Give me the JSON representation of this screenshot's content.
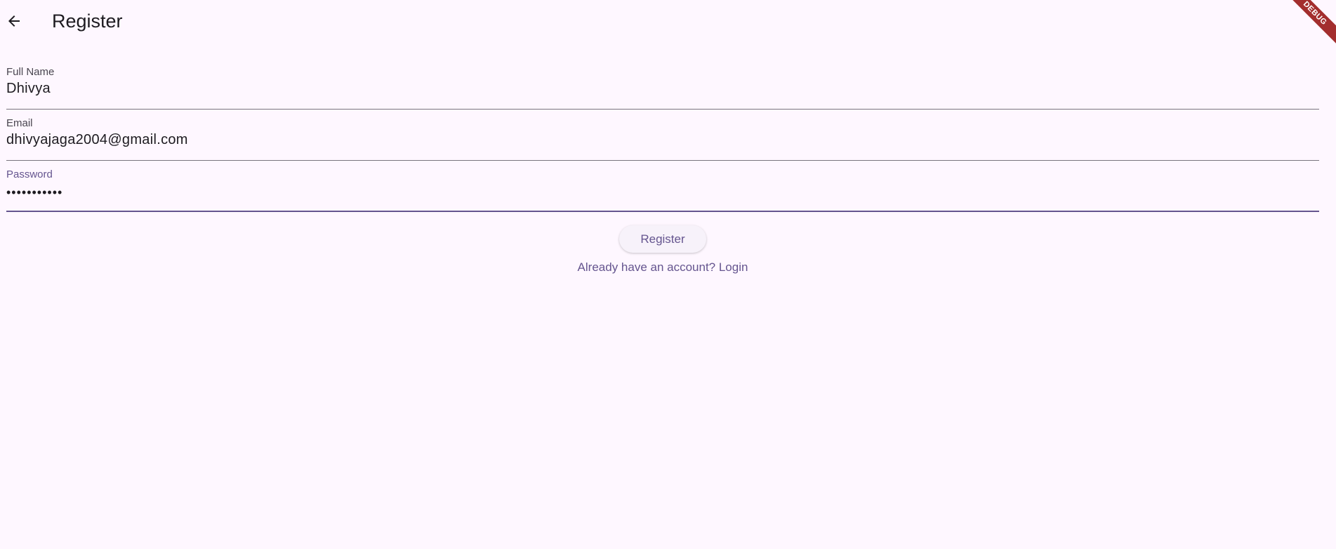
{
  "appbar": {
    "back_icon": "arrow-back-icon",
    "title": "Register"
  },
  "form": {
    "full_name": {
      "label": "Full Name",
      "value": "Dhivya"
    },
    "email": {
      "label": "Email",
      "value": "dhivyajaga2004@gmail.com"
    },
    "password": {
      "label": "Password",
      "value": "•••••••••••"
    }
  },
  "actions": {
    "register_label": "Register",
    "login_link": "Already have an account? Login"
  },
  "debug_banner": "DEBUG",
  "colors": {
    "background": "#FEF7FF",
    "primary": "#65558F",
    "banner": "#A32E2E"
  }
}
